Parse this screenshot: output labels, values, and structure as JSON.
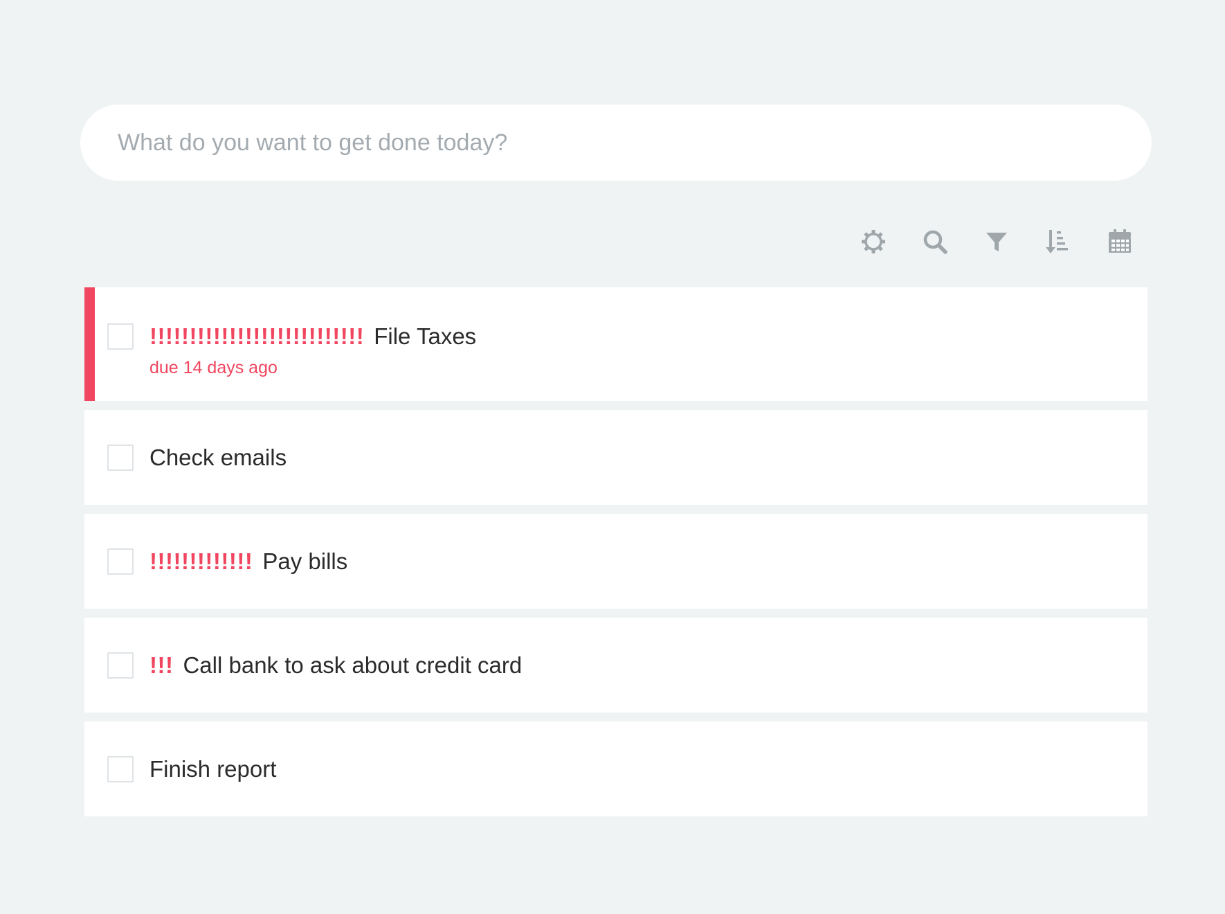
{
  "input": {
    "placeholder": "What do you want to get done today?"
  },
  "toolbar": {
    "icons": [
      "settings-icon",
      "search-icon",
      "filter-icon",
      "sort-icon",
      "calendar-icon"
    ],
    "icon_color": "#a0a7ab"
  },
  "colors": {
    "background": "#f0f3f4",
    "accent": "#f0465f",
    "placeholder": "#a4abb0"
  },
  "tasks": [
    {
      "priority": "!!!!!!!!!!!!!!!!!!!!!!!!!!!",
      "text": "File Taxes",
      "due": "due 14 days ago",
      "checked": false
    },
    {
      "priority": "",
      "text": "Check emails",
      "checked": false
    },
    {
      "priority": "!!!!!!!!!!!!!",
      "text": "Pay bills",
      "checked": false
    },
    {
      "priority": "!!!",
      "text": "Call bank to ask about credit card",
      "checked": false
    },
    {
      "priority": "",
      "text": "Finish report",
      "checked": false
    }
  ]
}
